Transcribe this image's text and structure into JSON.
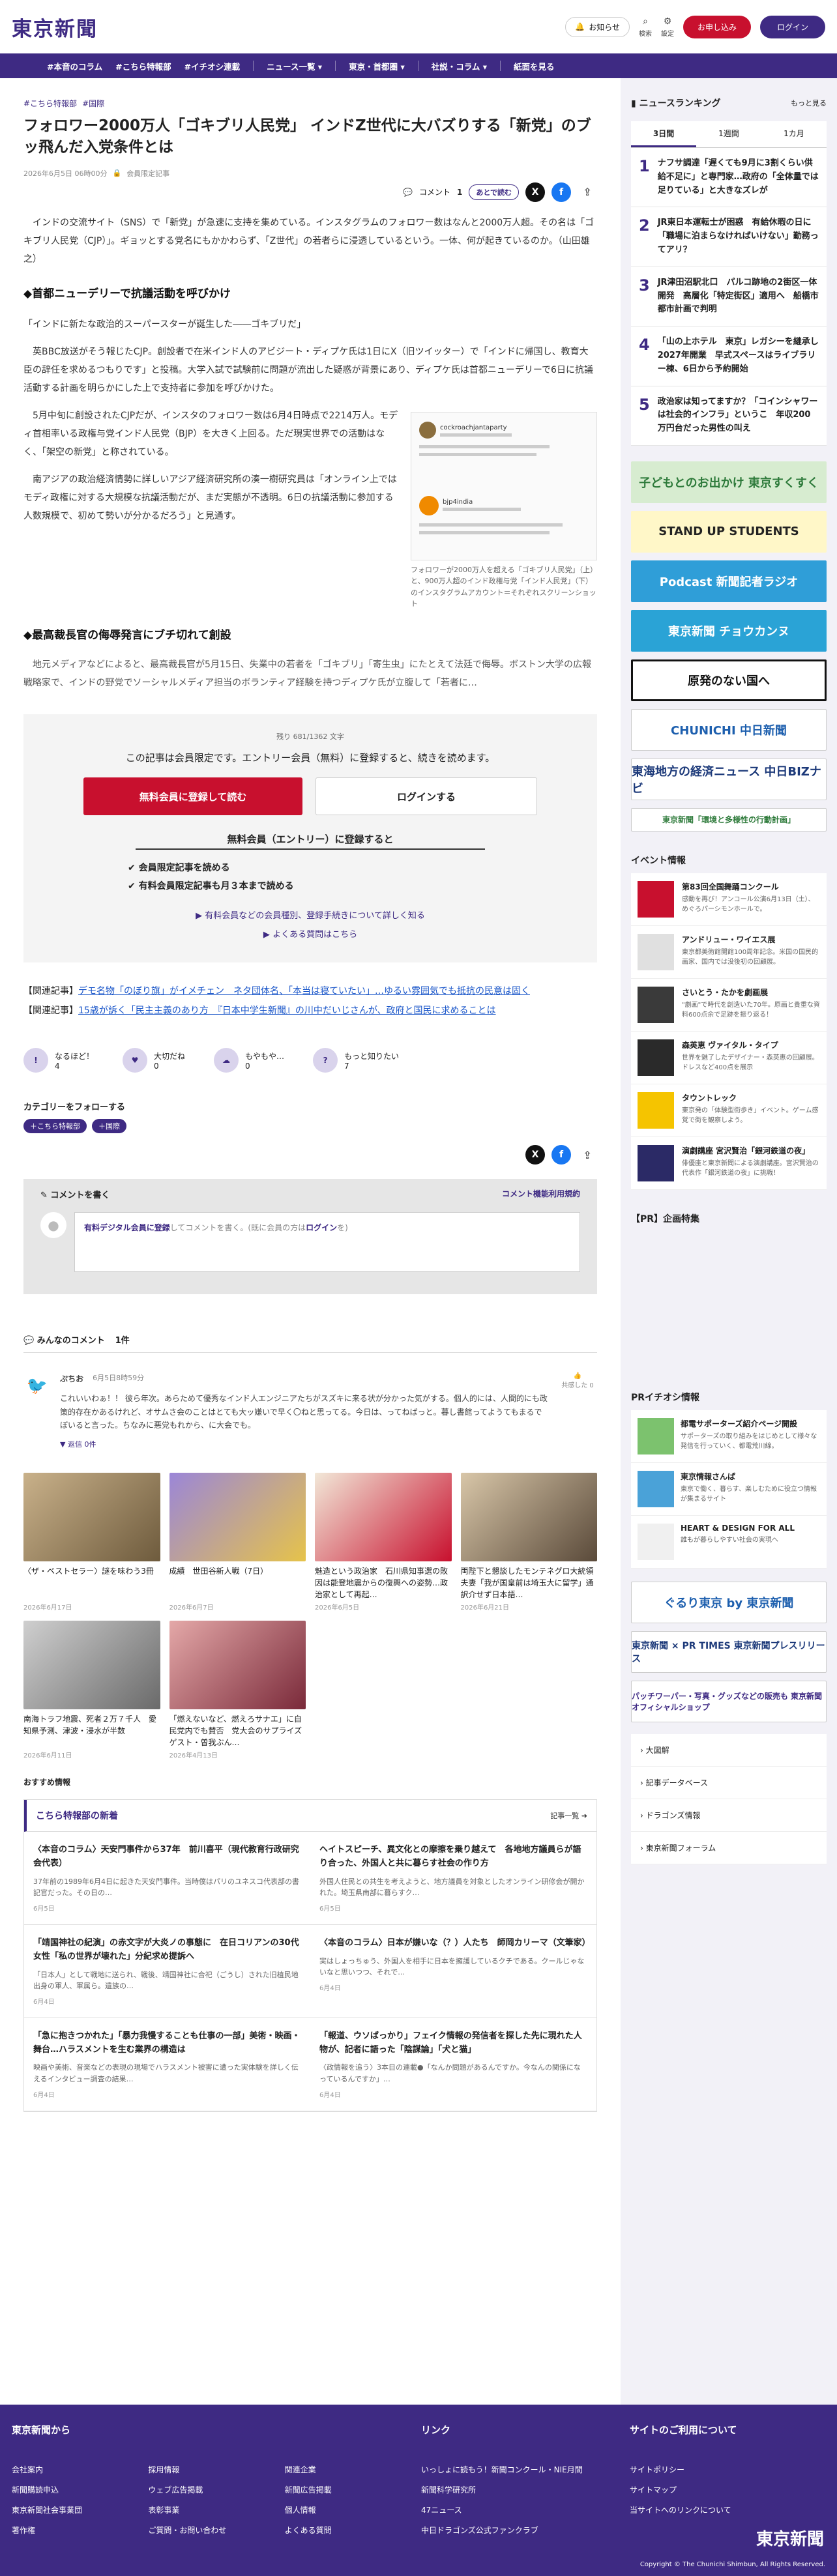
{
  "header": {
    "logo": "東京新聞",
    "notice": "お知らせ",
    "search": "検索",
    "settings": "設定",
    "apply": "お申し込み",
    "login": "ログイン"
  },
  "nav": [
    "#本音のコラム",
    "#こちら特報部",
    "#イチオシ連載",
    "ニュース一覧 ▾",
    "東京・首都圏 ▾",
    "社説・コラム ▾",
    "紙面を見る"
  ],
  "article": {
    "tags": [
      "#こちら特報部",
      "#国際"
    ],
    "title": "フォロワー2000万人「ゴキブリ人民党」 インドZ世代に大バズりする「新党」のブッ飛んだ入党条件とは",
    "date": "2026年6月5日 06時00分",
    "badge": "会員限定記事",
    "comment_label": "コメント",
    "comment_count": "1",
    "read_later": "あとで読む",
    "lead": "インドの交流サイト（SNS）で「新党」が急速に支持を集めている。インスタグラムのフォロワー数はなんと2000万人超。その名は「ゴキブリ人民党（CJP）」。ギョッとする党名にもかかわらず、「Z世代」の若者らに浸透しているという。一体、何が起きているのか。（山田雄之）",
    "h1": "◆首都ニューデリーで抗議活動を呼びかけ",
    "quote": "「インドに新たな政治的スーパースターが誕生した――ゴキブリだ」",
    "p1": "英BBC放送がそう報じたCJP。創設者で在米インド人のアビジート・ディプケ氏は1日にX（旧ツイッター）で「インドに帰国し、教育大臣の辞任を求めるつもりです」と投稿。大学入試で試験前に問題が流出した疑惑が背景にあり、ディプケ氏は首都ニューデリーで6日に抗議活動する計画を明らかにした上で支持者に参加を呼びかけた。",
    "p2": "5月中旬に創設されたCJPだが、インスタのフォロワー数は6月4日時点で2214万人。モディ首相率いる政権与党インド人民党（BJP）を大きく上回る。ただ現実世界での活動はなく、「架空の新党」と称されている。",
    "p3": "南アジアの政治経済情勢に詳しいアジア経済研究所の湊一樹研究員は「オンライン上ではモディ政権に対する大規模な抗議活動だが、まだ実態が不透明。6日の抗議活動に参加する人数規模で、初めて勢いが分かるだろう」と見通す。",
    "h2": "◆最高裁長官の侮辱発言にブチ切れて創設",
    "p4": "地元メディアなどによると、最高裁長官が5月15日、失業中の若者を「ゴキブリ」「寄生虫」にたとえて法廷で侮辱。ボストン大学の広報戦略家で、インドの野党でソーシャルメディア担当のボランティア経験を持つディプケ氏が立腹して「若者に…",
    "figure_user1": "cockroachjantaparty",
    "figure_user2": "bjp4india",
    "figure_caption": "フォロワーが2000万人を超える「ゴキブリ人民党」（上）と、900万人超のインド政権与党「インド人民党」（下）のインスタグラムアカウント＝それぞれスクリーンショット"
  },
  "paywall": {
    "remaining": "残り 681/1362 文字",
    "message": "この記事は会員限定です。エントリー会員（無料）に登録すると、続きを読めます。",
    "register": "無料会員に登録して読む",
    "login": "ログインする",
    "sub_title": "無料会員（エントリー）に登録すると",
    "benefit1": "会員限定記事を読める",
    "benefit2": "有料会員限定記事も月３本まで読める",
    "link1": "有料会員などの会員種別、登録手続きについて詳しく知る",
    "link2": "よくある質問はこちら"
  },
  "related": [
    {
      "label": "【関連記事】",
      "text": "デモ名物「のぼり旗」がイメチェン　ネタ団体名、「本当は寝ていたい」…ゆるい雰囲気でも抵抗の民意は固く"
    },
    {
      "label": "【関連記事】",
      "text": "15歳が訴く「民主主義のあり方　『日本中学生新聞』の川中だいじさんが、政府と国民に求めることは"
    }
  ],
  "reactions": [
    {
      "label": "なるほど！",
      "count": "4"
    },
    {
      "label": "大切だね",
      "count": "0"
    },
    {
      "label": "もやもや…",
      "count": "0"
    },
    {
      "label": "もっと知りたい",
      "count": "7"
    }
  ],
  "follow": {
    "title": "カテゴリーをフォローする",
    "tags": [
      "＋こちら特報部",
      "＋国際"
    ]
  },
  "comment_box": {
    "title": "コメントを書く",
    "terms": "コメント機能利用規約",
    "prompt_member": "有料デジタル会員に登録",
    "prompt_mid": "してコメントを書く。(既に会員の方は",
    "prompt_login": "ログイン",
    "prompt_end": "を)"
  },
  "comments": {
    "title": "みんなのコメント",
    "count": "1件",
    "items": [
      {
        "user": "ぷちお",
        "date": "6月5日8時59分",
        "text": "これいいわぁ！！ 彼ら年次。あらためて優秀なインド人エンジニアたちがスズキに来る状が分かった気がする。個人的には、人間的にも政策的存在かあるけれど、オサムさ会のことはとても大ッ嫌いで早く〇ねと思ってる。今日は、ってねばっと。暮し書館ってようてもまるでぼいると言った。ちなみに悪党もれから、に大会でも。",
        "reply": "返信 0件",
        "side": "共感した 0"
      }
    ]
  },
  "cards": [
    {
      "title": "〈ザ・ベストセラー〉謎を味わう3冊",
      "date": "2026年6月17日"
    },
    {
      "title": "成績　世田谷新人戦（7日）",
      "date": "2026年6月7日"
    },
    {
      "title": "魅造という政治家　石川県知事選の敗因は能登地震からの復興への姿勢…政治家として再起…",
      "date": "2026年6月5日"
    },
    {
      "title": "両陛下と懇談したモンテネグロ大統領夫妻「我が国皇前は埼玉大に留学」通訳介せず日本語…",
      "date": "2026年6月21日"
    },
    {
      "title": "南海トラフ地震、死者２万７千人　愛知県予測、津波・浸水が半数",
      "date": "2026年6月11日"
    },
    {
      "title": "「燃えないなど、燃えろサナエ」に自民党内でも賛否　党大会のサプライズゲスト・曽我ぶん…",
      "date": "2026年4月13日"
    }
  ],
  "recommend": {
    "label": "おすすめ情報",
    "box_title": "こちら特報部の新着",
    "box_more": "記事一覧",
    "items": [
      {
        "title": "〈本音のコラム〉天安門事件から37年　前川喜平（現代教育行政研究会代表）",
        "desc": "37年前の1989年6月4日に起きた天安門事件。当時僕はパリのユネスコ代表部の書記官だった。その日の…",
        "date": "6月5日"
      },
      {
        "title": "ヘイトスピーチ、異文化との摩擦を乗り越えて　各地地方議員らが語り合った、外国人と共に暮らす社会の作り方",
        "desc": "外国人住民との共生を考えようと、地方議員を対象としたオンライン研修会が開かれた。埼玉県南部に暮らすク…",
        "date": "6月5日"
      },
      {
        "title": "「靖国神社の紀演」の赤文字が大炎ノの事態に　在日コリアンの30代女性「私の世界が壊れた」分紀求め提訴へ",
        "desc": "「日本人」として戦地に送られ、戦後、靖国神社に合祀（ごうし）された旧植民地出身の軍人、軍属ら。遺族の…",
        "date": "6月4日"
      },
      {
        "title": "〈本音のコラム〉日本が嫌いな（？）人たち　師岡カリーマ（文筆家）",
        "desc": "実はしょっちゅう、外国人を相手に日本を擁護しているクチである。クールじゃないなと思いつつ、それで…",
        "date": "6月4日"
      },
      {
        "title": "「急に抱きつかれた」「暴力我慢することも仕事の一部」美術・映画・舞台…ハラスメントを生む業界の構造は",
        "desc": "映画や美術、音楽などの表現の現場でハラスメント被害に遭った実体験を詳しく伝えるインタビュー調査の結果…",
        "date": "6月4日"
      },
      {
        "title": "「報道、ウソばっかり」フェイク情報の発信者を探した先に現れた人物が、記者に語った「陰謀論」「犬と猫」",
        "desc": "〈政情報を追う〉3本目の連載●「なんか問題があるんですか。今なんの関係になっているんですか」…",
        "date": "6月4日"
      }
    ]
  },
  "sidebar": {
    "ranking_title": "ニュースランキング",
    "ranking_more": "もっと見る",
    "tabs": [
      "3日間",
      "1週間",
      "1カ月"
    ],
    "ranks": [
      {
        "num": "1",
        "text": "ナフサ調達「遅くても9月に3割くらい供給不足に」と専門家…政府の「全体量では足りている」と大きなズレが"
      },
      {
        "num": "2",
        "text": "JR東日本運転士が困惑　有給休暇の日に「職場に泊まらなければいけない」勤務ってアリ？"
      },
      {
        "num": "3",
        "text": "JR津田沼駅北口　パルコ跡地の2街区一体開発　高層化「特定街区」適用へ　船橋市都市計画で判明"
      },
      {
        "num": "4",
        "text": "「山の上ホテル　東京」レガシーを継承し2027年開業　早式スペースはライブラリー棟、6日から予約開始"
      },
      {
        "num": "5",
        "text": "政治家は知ってますか？「コインシャワーは社会的インフラ」というこ　年収200万円台だった男性の叫え"
      }
    ],
    "banners": [
      "子どもとのお出かけ 東京すくすく",
      "STAND UP STUDENTS",
      "Podcast 新聞記者ラジオ",
      "東京新聞 チョウカンヌ",
      "原発のない国へ",
      "CHUNICHI 中日新聞",
      "東海地方の経済ニュース 中日BIZナビ",
      "東京新聞「環境と多様性の行動計画」"
    ],
    "event_title": "イベント情報",
    "events": [
      {
        "title": "第83回全国舞踊コンクール",
        "desc": "感動を再び！アンコール公演6月13日（土）、めぐろパーシモンホールで。"
      },
      {
        "title": "アンドリュー・ワイエス展",
        "desc": "東京都美術館開館100周年記念。米国の国民的画家、国内では没後初の回顧展。"
      },
      {
        "title": "さいとう・たかを劇画展",
        "desc": "\"劇画\"で時代を創造いた70年。原画と貴重な資料600点余で足跡を振り返る！"
      },
      {
        "title": "森英恵 ヴァイタル・タイプ",
        "desc": "世界を魅了したデザイナー・森英恵の回顧展。ドレスなど400点を展示"
      },
      {
        "title": "タウントレック",
        "desc": "東京発の「体験型街歩き」イベント。ゲーム感覚で街を観察しよう。"
      },
      {
        "title": "演劇講座 宮沢賢治「銀河鉄道の夜」",
        "desc": "俳優座と東京新聞による演劇講座。宮沢賢治の代表作「銀河鉄道の夜」に挑戦！"
      }
    ],
    "pr_feature": "【PR】企画特集",
    "pr_title": "PRイチオシ情報",
    "pr_items": [
      {
        "title": "都電サポーターズ紹介ページ開設",
        "desc": "サポーターズの取り組みをはじめとして様々な発信を行っていく、都電荒川線。"
      },
      {
        "title": "東京情報さんぱ",
        "desc": "東京で働く、暮らす、楽しむために役立つ情報が集まるサイト"
      },
      {
        "title": "HEART & DESIGN FOR ALL",
        "desc": "誰もが暮らしやすい社会の実現へ"
      }
    ],
    "pr_banners": [
      "ぐるり東京 by 東京新聞",
      "東京新聞 × PR TIMES 東京新聞プレスリリース",
      "パッチワーパー・写真・グッズなどの販売も 東京新聞オフィシャルショップ"
    ],
    "links": [
      "大図解",
      "記事データベース",
      "ドラゴンズ情報",
      "東京新聞フォーラム"
    ]
  },
  "footer": {
    "col1_title": "東京新聞から",
    "col1_links": [
      "会社案内",
      "採用情報",
      "関連企業",
      "新聞購読申込",
      "ウェブ広告掲載",
      "新聞広告掲載",
      "東京新聞社会事業団",
      "表彰事業",
      "個人情報",
      "著作権",
      "ご質問・お問い合わせ",
      "よくある質問"
    ],
    "col2_title": "リンク",
    "col2_links": [
      "いっしょに読もう！新聞コンクール・NIE月間",
      "新聞科学研究所",
      "47ニュース",
      "中日ドラゴンズ公式ファンクラブ"
    ],
    "col3_title": "サイトのご利用について",
    "col3_links": [
      "サイトポリシー",
      "サイトマップ",
      "当サイトへのリンクについて"
    ],
    "logo": "東京新聞",
    "copyright": "Copyright © The Chunichi Shimbun, All Rights Reserved."
  }
}
